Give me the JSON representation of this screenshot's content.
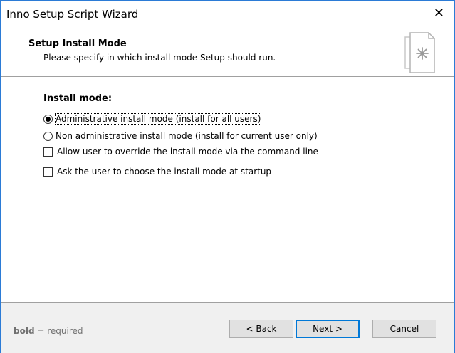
{
  "window": {
    "title": "Inno Setup Script Wizard",
    "close_glyph": "✕"
  },
  "header": {
    "title": "Setup Install Mode",
    "description": "Please specify in which install mode Setup should run.",
    "icon": "document-asterisk-icon"
  },
  "install_mode": {
    "label": "Install mode:",
    "options": [
      {
        "label": "Administrative install mode (install for all users)",
        "selected": true
      },
      {
        "label": "Non administrative install mode (install for current user only)",
        "selected": false
      }
    ]
  },
  "checkboxes": [
    {
      "label": "Allow user to override the install mode via the command line",
      "checked": false
    },
    {
      "label": "Ask the user to choose the install mode at startup",
      "checked": false
    }
  ],
  "footer": {
    "note_bold": "bold",
    "note_rest": " = required",
    "back_label": "< Back",
    "next_label": "Next >",
    "cancel_label": "Cancel"
  },
  "colors": {
    "accent": "#0078d7",
    "window_border": "#2b7bd6",
    "footer_bg": "#f0f0f0"
  }
}
